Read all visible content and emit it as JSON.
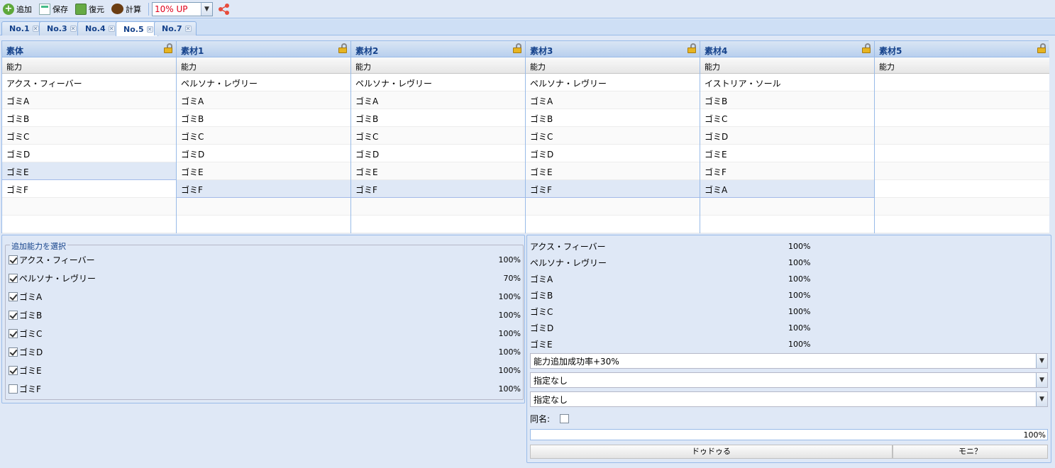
{
  "toolbar": {
    "add_label": "追加",
    "save_label": "保存",
    "restore_label": "復元",
    "calc_label": "計算",
    "rate_select": "10% UP"
  },
  "tabs": [
    {
      "label": "No.1"
    },
    {
      "label": "No.3"
    },
    {
      "label": "No.4"
    },
    {
      "label": "No.5",
      "active": true
    },
    {
      "label": "No.7"
    }
  ],
  "grids": [
    {
      "title": "素体",
      "subheader": "能力",
      "rows": [
        "アクス・フィーバー",
        "ゴミA",
        "ゴミB",
        "ゴミC",
        "ゴミD",
        "ゴミE",
        "ゴミF",
        "",
        ""
      ],
      "selected_row": 5
    },
    {
      "title": "素材1",
      "subheader": "能力",
      "rows": [
        "ペルソナ・レヴリー",
        "ゴミA",
        "ゴミB",
        "ゴミC",
        "ゴミD",
        "ゴミE",
        "ゴミF",
        "",
        ""
      ],
      "selected_row": 6
    },
    {
      "title": "素材2",
      "subheader": "能力",
      "rows": [
        "ペルソナ・レヴリー",
        "ゴミA",
        "ゴミB",
        "ゴミC",
        "ゴミD",
        "ゴミE",
        "ゴミF",
        "",
        ""
      ],
      "selected_row": 6
    },
    {
      "title": "素材3",
      "subheader": "能力",
      "rows": [
        "ペルソナ・レヴリー",
        "ゴミA",
        "ゴミB",
        "ゴミC",
        "ゴミD",
        "ゴミE",
        "ゴミF",
        "",
        ""
      ],
      "selected_row": 6
    },
    {
      "title": "素材4",
      "subheader": "能力",
      "rows": [
        "イストリア・ソール",
        "ゴミB",
        "ゴミC",
        "ゴミD",
        "ゴミE",
        "ゴミF",
        "ゴミA",
        "",
        ""
      ],
      "selected_row": 6
    },
    {
      "title": "素材5",
      "subheader": "能力",
      "rows": [
        "",
        "",
        "",
        "",
        "",
        "",
        "",
        "",
        ""
      ],
      "selected_row": -1
    }
  ],
  "ability_select": {
    "legend": "追加能力を選択",
    "items": [
      {
        "label": "アクス・フィーバー",
        "checked": true,
        "value": "100%"
      },
      {
        "label": "ペルソナ・レヴリー",
        "checked": true,
        "value": "70%"
      },
      {
        "label": "ゴミA",
        "checked": true,
        "value": "100%"
      },
      {
        "label": "ゴミB",
        "checked": true,
        "value": "100%"
      },
      {
        "label": "ゴミC",
        "checked": true,
        "value": "100%"
      },
      {
        "label": "ゴミD",
        "checked": true,
        "value": "100%"
      },
      {
        "label": "ゴミE",
        "checked": true,
        "value": "100%"
      },
      {
        "label": "ゴミF",
        "checked": false,
        "value": "100%"
      }
    ]
  },
  "results": [
    {
      "label": "アクス・フィーバー",
      "value": "100%"
    },
    {
      "label": "ペルソナ・レヴリー",
      "value": "100%"
    },
    {
      "label": "ゴミA",
      "value": "100%"
    },
    {
      "label": "ゴミB",
      "value": "100%"
    },
    {
      "label": "ゴミC",
      "value": "100%"
    },
    {
      "label": "ゴミD",
      "value": "100%"
    },
    {
      "label": "ゴミE",
      "value": "100%"
    }
  ],
  "dropdowns": [
    "能力追加成功率+30%",
    "指定なし",
    "指定なし"
  ],
  "same_name_label": "同名:",
  "same_name_checked": false,
  "progress": {
    "value": 1.0,
    "label": "100%"
  },
  "buttons": {
    "left": "ドゥドゥる",
    "right": "モニ？"
  },
  "colors": {
    "accent": "#15428b",
    "panel_bg": "#dfe8f6",
    "border": "#99bbe8",
    "rate_text": "#e0001a"
  }
}
